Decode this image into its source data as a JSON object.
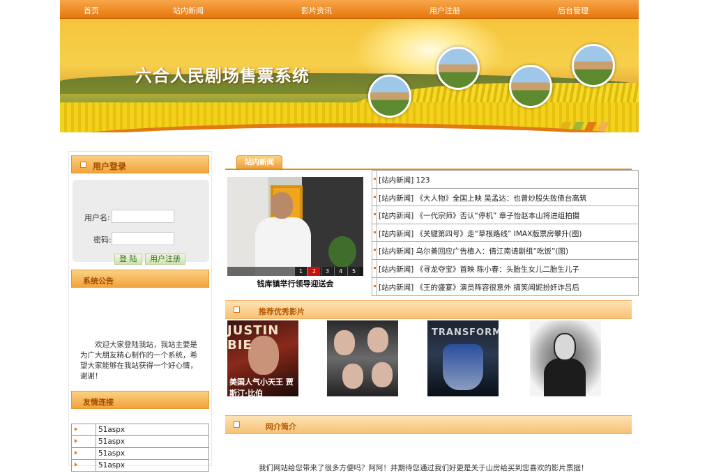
{
  "nav": {
    "items": [
      "首页",
      "站内新闻",
      "影片资讯",
      "用户注册",
      "后台管理"
    ]
  },
  "banner": {
    "title": "六合人民剧场售票系统"
  },
  "login": {
    "heading": "用户登录",
    "username_label": "用户名:",
    "password_label": "密码:",
    "login_button": "登 陆",
    "register_button": "用户注册"
  },
  "notice": {
    "heading": "系统公告",
    "text": "欢迎大家登陆我站，我站主要是为广大朋友精心制作的一个系统，希望大家能够在我站获得一个好心情，谢谢！"
  },
  "links": {
    "heading": "友情连接",
    "items": [
      "51aspx",
      "51aspx",
      "51aspx",
      "51aspx"
    ]
  },
  "news": {
    "tab": "站内新闻",
    "photo_caption": "钱库镇举行领导迎送会",
    "pager": [
      "1",
      "2",
      "3",
      "4",
      "5"
    ],
    "pager_active": "2",
    "items": [
      "[站内新闻] 123",
      "[站内新闻] 《大人物》全国上映 吴孟达：也曾炒股失败债台高筑",
      "[站内新闻] 《一代宗师》否认“停机” 章子怡赵本山将进组拍摄",
      "[站内新闻] 《关键第四号》走“草根路线” IMAX版票房攀升(图)",
      "[站内新闻] 乌尔善回应广告植入：倩江南请剧组“吃饭”(图)",
      "[站内新闻] 《寻龙夺宝》首映 陈小春：头胎生女儿二胎生儿子",
      "[站内新闻] 《王的盛宴》演员阵容很意外 搞笑闻妮扮奸诈吕后"
    ]
  },
  "films": {
    "heading": "推荐优秀影片",
    "poster1_title": "JUSTIN BIE",
    "poster1_cn": "美国人气小天王 贾斯汀·比伯",
    "poster3_title": "TRANSFORMERS"
  },
  "intro": {
    "heading": "网介简介",
    "text": "我们网站给您带来了很多方便吗？阿阿！并期待您通过我们好更是关于山房给买到您喜欢的影片票据！"
  },
  "colors": {
    "accent": "#e6770a",
    "heading_text": "#a24a00"
  }
}
